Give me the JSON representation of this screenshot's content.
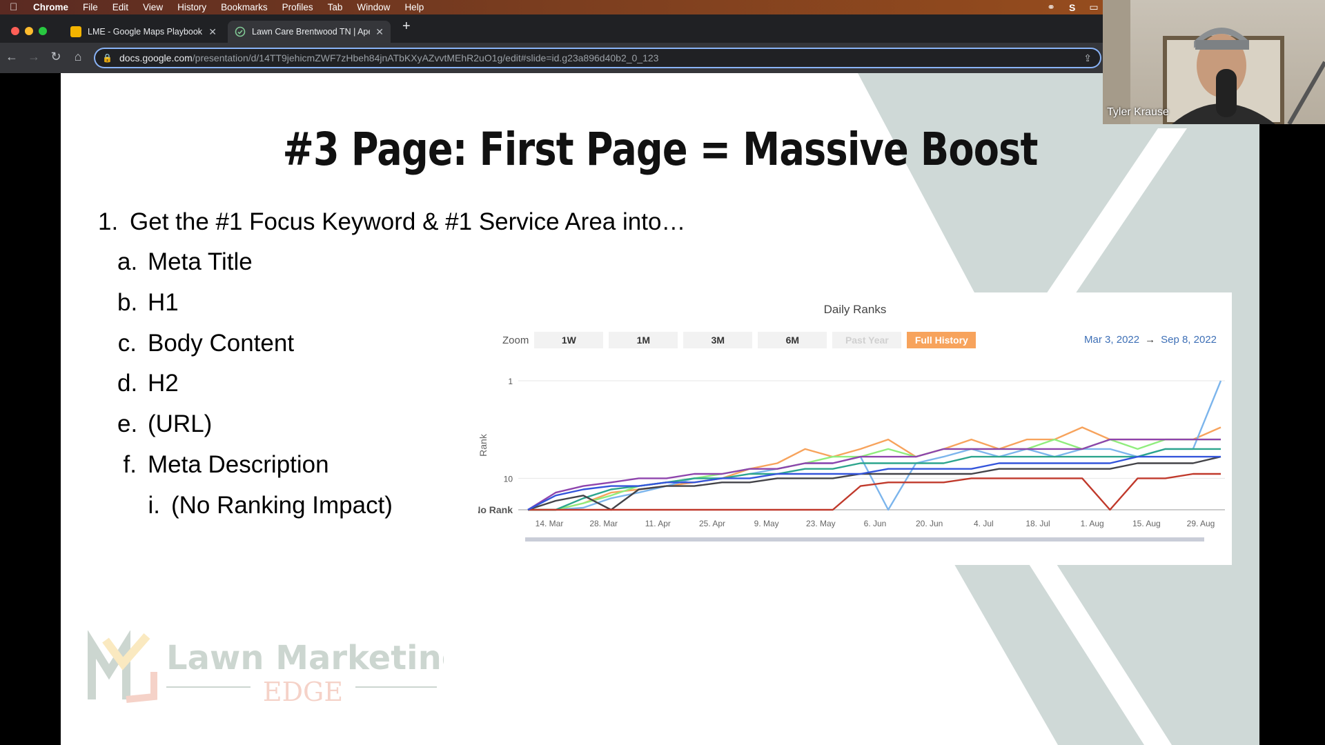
{
  "menubar": {
    "app": "Chrome",
    "items": [
      "File",
      "Edit",
      "View",
      "History",
      "Bookmarks",
      "Profiles",
      "Tab",
      "Window",
      "Help"
    ]
  },
  "tabs": [
    {
      "title": "LME - Google Maps Playbook V",
      "icon": "google-slides-icon",
      "active": false
    },
    {
      "title": "Lawn Care Brentwood TN | Apex",
      "icon": "site-favicon-icon",
      "active": true
    }
  ],
  "address": {
    "domain": "docs.google.com",
    "path": "/presentation/d/14TT9jehicmZWF7zHbeh84jnATbKXyAZvvtMEhR2uO1g/edit#slide=id.g23a896d40b2_0_123"
  },
  "slide": {
    "title": "#3 Page: First Page = Massive Boost",
    "bullets": [
      {
        "marker": "1.",
        "text": "Get the #1 Focus Keyword & #1 Service Area into…"
      },
      {
        "marker": "a.",
        "text": "Meta Title"
      },
      {
        "marker": "b.",
        "text": "H1"
      },
      {
        "marker": "c.",
        "text": "Body Content"
      },
      {
        "marker": "d.",
        "text": "H2"
      },
      {
        "marker": "e.",
        "text": "(URL)"
      },
      {
        "marker": "f.",
        "text": "Meta Description"
      },
      {
        "marker": "i.",
        "text": "(No Ranking Impact)"
      }
    ],
    "logo": {
      "line1": "Lawn Marketing",
      "line2": "EDGE"
    }
  },
  "chart_controls": {
    "zoom_label": "Zoom",
    "buttons": [
      {
        "label": "1W",
        "state": "normal"
      },
      {
        "label": "1M",
        "state": "normal"
      },
      {
        "label": "3M",
        "state": "normal"
      },
      {
        "label": "6M",
        "state": "normal"
      },
      {
        "label": "Past Year",
        "state": "disabled"
      },
      {
        "label": "Full History",
        "state": "active"
      }
    ],
    "date_from": "Mar 3, 2022",
    "arrow": "→",
    "date_to": "Sep 8, 2022"
  },
  "chart_data": {
    "type": "line",
    "title": "Daily Ranks",
    "ylabel": "Rank",
    "xlabel": "",
    "y_ticks": [
      "1",
      "10",
      "No Rank"
    ],
    "x_ticks": [
      "14. Mar",
      "28. Mar",
      "11. Apr",
      "25. Apr",
      "9. May",
      "23. May",
      "6. Jun",
      "20. Jun",
      "4. Jul",
      "18. Jul",
      "1. Aug",
      "15. Aug",
      "29. Aug"
    ],
    "y_scale": "log-rank",
    "grid": true,
    "legend": "none",
    "series": [
      {
        "color": "#f7a35c",
        "values": [
          21,
          21,
          18,
          14,
          13,
          12,
          11,
          10,
          8,
          7,
          5,
          6,
          5,
          4,
          6,
          5,
          4,
          5,
          4,
          4,
          3,
          4,
          4,
          4,
          4,
          3
        ]
      },
      {
        "color": "#7cb5ec",
        "values": [
          21,
          21,
          20,
          16,
          14,
          12,
          10,
          10,
          9,
          8,
          7,
          7,
          6,
          21,
          7,
          6,
          5,
          6,
          5,
          6,
          5,
          5,
          6,
          5,
          5,
          1
        ]
      },
      {
        "color": "#90ed7d",
        "values": [
          21,
          21,
          18,
          15,
          12,
          11,
          10,
          9,
          8,
          8,
          7,
          6,
          6,
          5,
          6,
          5,
          5,
          5,
          5,
          4,
          5,
          4,
          5,
          4,
          4,
          4
        ]
      },
      {
        "color": "#8e44ad",
        "values": [
          21,
          14,
          12,
          11,
          10,
          10,
          9,
          9,
          8,
          8,
          7,
          7,
          6,
          6,
          6,
          5,
          5,
          5,
          5,
          5,
          5,
          4,
          4,
          4,
          4,
          4
        ]
      },
      {
        "color": "#2ca58d",
        "values": [
          21,
          21,
          16,
          13,
          12,
          11,
          10,
          10,
          9,
          9,
          8,
          8,
          7,
          7,
          7,
          7,
          6,
          6,
          6,
          6,
          6,
          6,
          6,
          5,
          5,
          5
        ]
      },
      {
        "color": "#434348",
        "values": [
          21,
          17,
          15,
          21,
          13,
          12,
          12,
          11,
          11,
          10,
          10,
          10,
          9,
          9,
          9,
          9,
          9,
          8,
          8,
          8,
          8,
          8,
          7,
          7,
          7,
          6
        ]
      },
      {
        "color": "#c0392b",
        "values": [
          21,
          21,
          21,
          21,
          21,
          21,
          21,
          21,
          21,
          21,
          21,
          21,
          12,
          11,
          11,
          11,
          10,
          10,
          10,
          10,
          10,
          21,
          10,
          10,
          9,
          9
        ]
      },
      {
        "color": "#3455db",
        "values": [
          21,
          15,
          13,
          12,
          12,
          11,
          11,
          10,
          10,
          9,
          9,
          9,
          9,
          8,
          8,
          8,
          8,
          7,
          7,
          7,
          7,
          7,
          6,
          6,
          6,
          6
        ]
      }
    ]
  },
  "webcam": {
    "name": "Tyler Krause"
  },
  "colors": {
    "accent": "#f7a35c",
    "slide_deco": "#cfd9d7",
    "date_text": "#3d6fb6"
  }
}
